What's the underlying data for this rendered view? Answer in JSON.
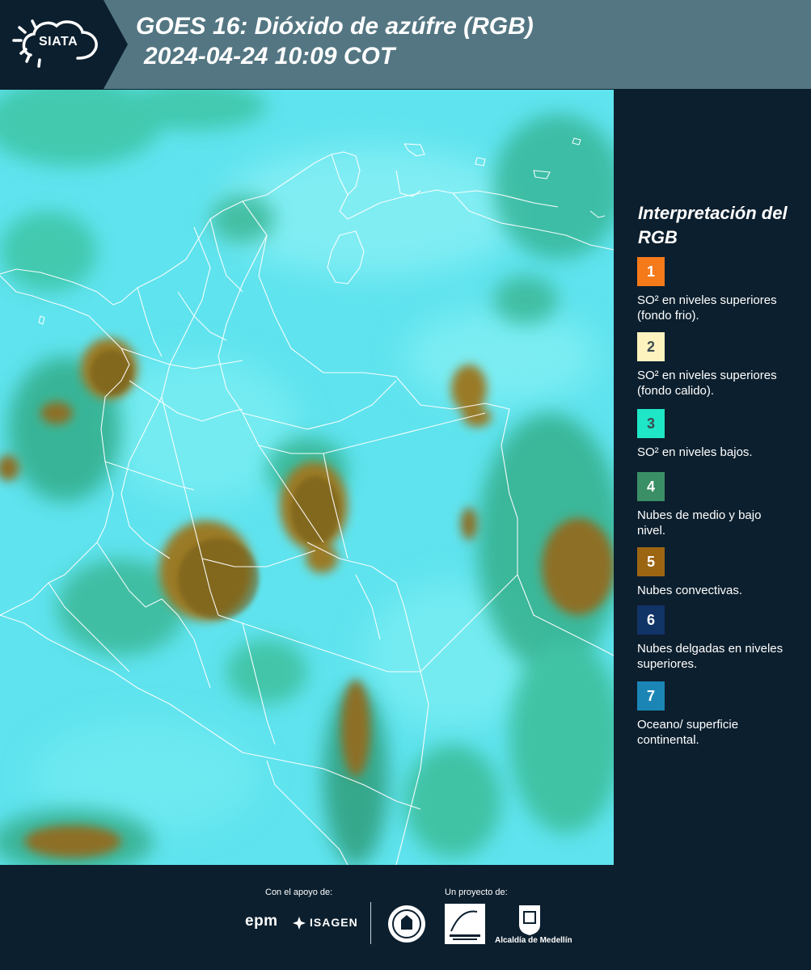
{
  "header": {
    "logo_text": "SIATA",
    "title": "GOES 16: Dióxido de azúfre (RGB)",
    "subtitle": "2024-04-24 10:09 COT"
  },
  "map": {
    "background_color": "#5fe3ee",
    "border_color": "#ffffff"
  },
  "legend": {
    "title": "Interpretación del RGB",
    "items": [
      {
        "number": "1",
        "label": "SO² en niveles superiores (fondo frio).",
        "color": "#f47a1a"
      },
      {
        "number": "2",
        "label": "SO² en niveles superiores (fondo calido).",
        "color": "#fdf3bf"
      },
      {
        "number": "3",
        "label": "SO² en niveles bajos.",
        "color": "#1fe6c6"
      },
      {
        "number": "4",
        "label": "Nubes de medio y bajo nivel.",
        "color": "#3a8f66"
      },
      {
        "number": "5",
        "label": "Nubes convectivas.",
        "color": "#9c6512"
      },
      {
        "number": "6",
        "label": "Nubes delgadas en niveles superiores.",
        "color": "#113467"
      },
      {
        "number": "7",
        "label": "Oceano/ superficie continental.",
        "color": "#1b86b6"
      }
    ]
  },
  "footer": {
    "support_label": "Con el apoyo de:",
    "project_label": "Un proyecto de:",
    "sponsor_1": "epm",
    "sponsor_2": "ISAGEN",
    "partner_3": "Alcaldía de Medellín"
  }
}
